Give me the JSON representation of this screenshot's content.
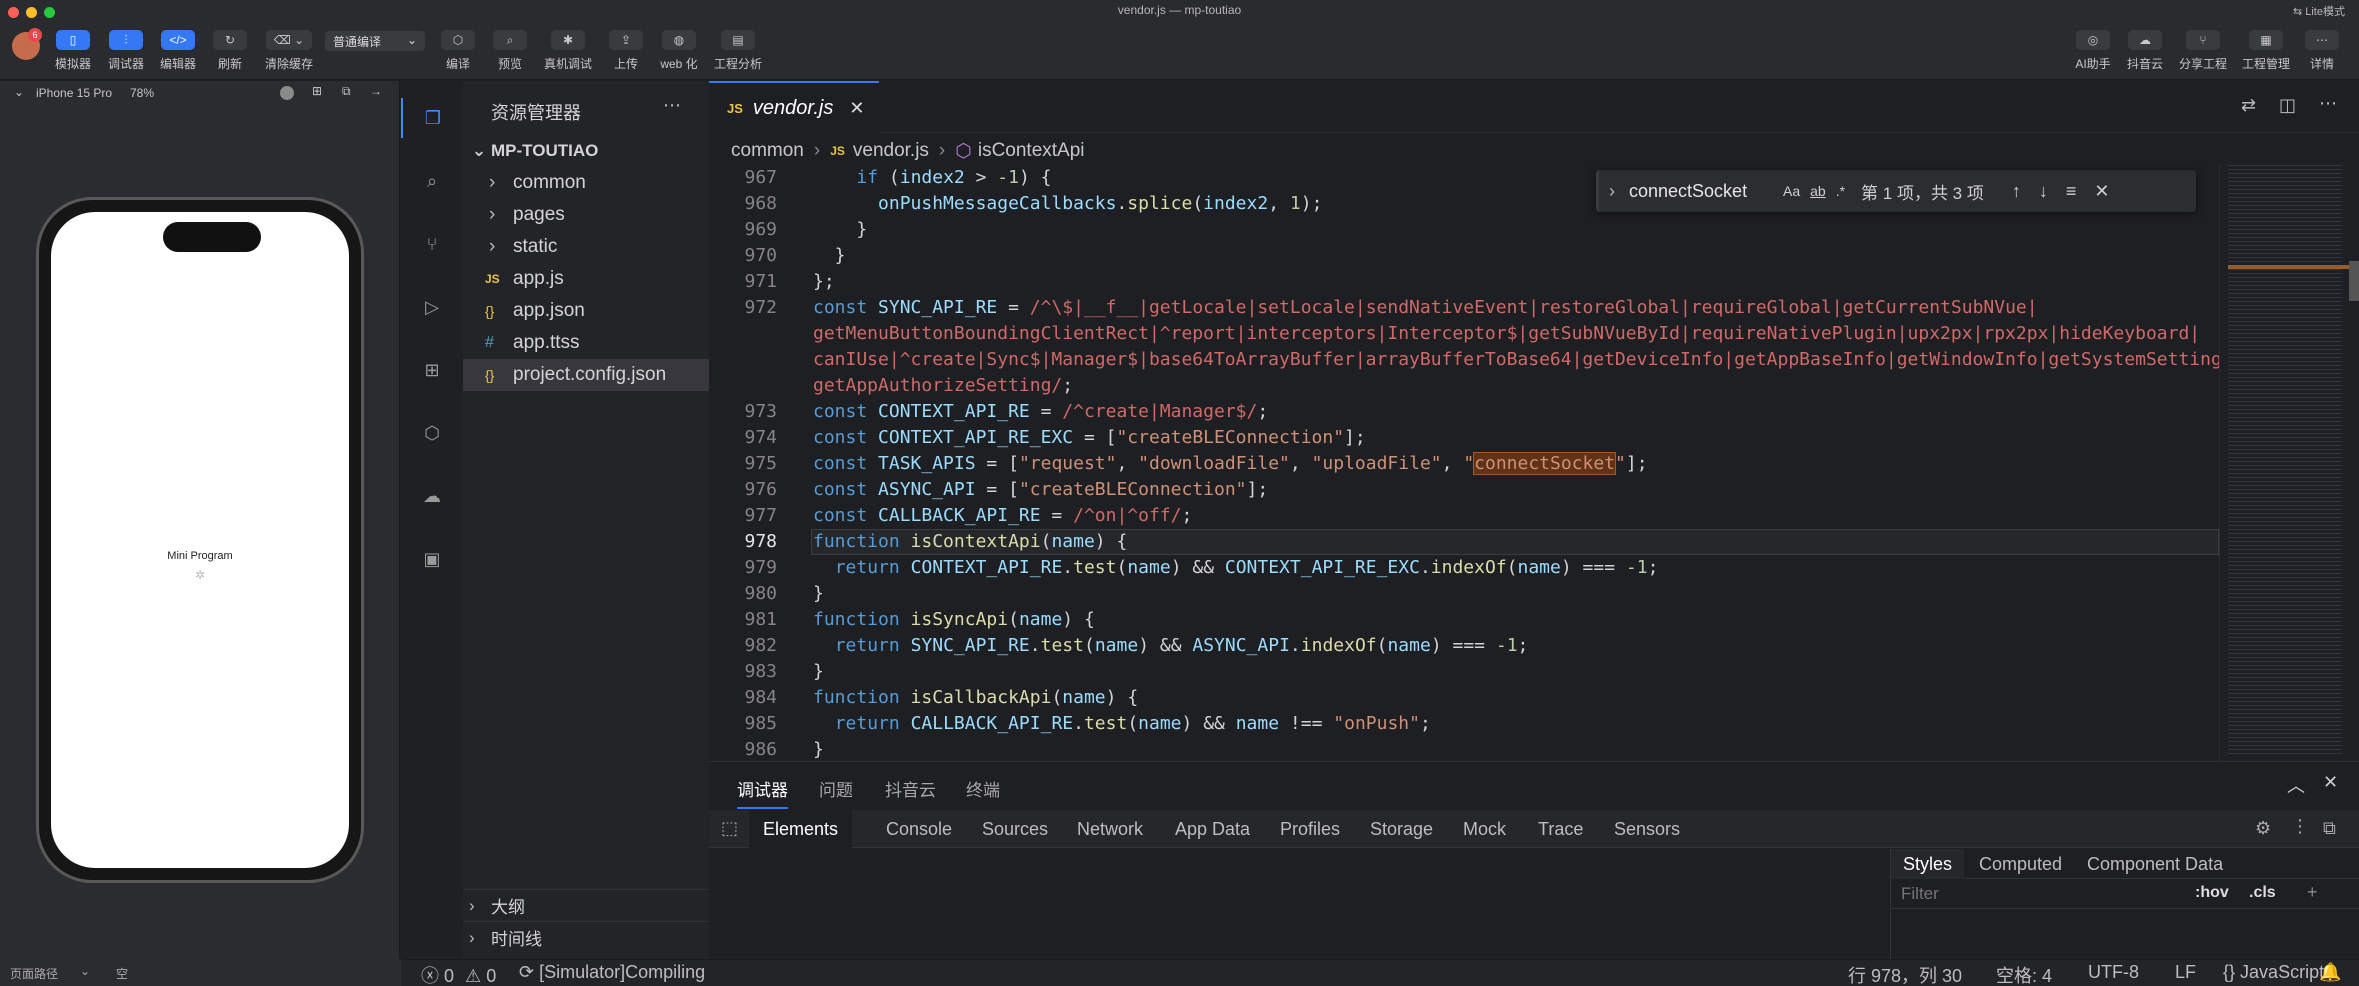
{
  "window": {
    "title": "vendor.js — mp-toutiao",
    "lite_mode": "Lite模式"
  },
  "toolbar": {
    "avatar_badge": "6",
    "left": [
      {
        "label": "模拟器",
        "icon": "phone-icon"
      },
      {
        "label": "调试器",
        "icon": "sliders-icon"
      },
      {
        "label": "编辑器",
        "icon": "code-icon"
      },
      {
        "label": "刷新",
        "icon": "refresh-icon"
      },
      {
        "label": "清除缓存",
        "icon": "clear-cache-icon"
      }
    ],
    "compile_mode": "普通编译",
    "middle": [
      {
        "label": "编译",
        "icon": "compile-icon"
      },
      {
        "label": "预览",
        "icon": "preview-icon"
      },
      {
        "label": "真机调试",
        "icon": "bug-icon"
      },
      {
        "label": "上传",
        "icon": "upload-icon"
      },
      {
        "label": "web 化",
        "icon": "globe-icon"
      },
      {
        "label": "工程分析",
        "icon": "analysis-icon"
      }
    ],
    "right": [
      {
        "label": "AI助手",
        "icon": "ai-icon"
      },
      {
        "label": "抖音云",
        "icon": "cloud-icon"
      },
      {
        "label": "分享工程",
        "icon": "share-icon"
      },
      {
        "label": "工程管理",
        "icon": "project-icon"
      },
      {
        "label": "详情",
        "icon": "details-icon"
      }
    ]
  },
  "simulator": {
    "device": "iPhone 15 Pro",
    "zoom": "78%",
    "screen_title": "Mini Program",
    "footer_path": "页面路径",
    "footer_empty": "空"
  },
  "explorer": {
    "title": "资源管理器",
    "project": "MP-TOUTIAO",
    "items": [
      {
        "name": "common",
        "type": "folder",
        "icon": ">"
      },
      {
        "name": "pages",
        "type": "folder",
        "icon": ">"
      },
      {
        "name": "static",
        "type": "folder",
        "icon": ">"
      },
      {
        "name": "app.js",
        "type": "js",
        "icon": "JS"
      },
      {
        "name": "app.json",
        "type": "json",
        "icon": "{}"
      },
      {
        "name": "app.ttss",
        "type": "css",
        "icon": "#"
      },
      {
        "name": "project.config.json",
        "type": "json",
        "icon": "{}",
        "selected": true
      }
    ],
    "outline": "大纲",
    "timeline": "时间线"
  },
  "editor": {
    "tab_label": "vendor.js",
    "tab_lang": "JS",
    "breadcrumb": [
      "common",
      "vendor.js",
      "isContextApi"
    ],
    "find": {
      "query": "connectSocket",
      "result": "第 1 项，共 3 项",
      "case": "Aa",
      "word": "ab",
      "regex": ".*"
    },
    "line_numbers": [
      "967",
      "968",
      "969",
      "970",
      "971",
      "972",
      "",
      "",
      "",
      "973",
      "974",
      "975",
      "976",
      "977",
      "978",
      "979",
      "980",
      "981",
      "982",
      "983",
      "984",
      "985",
      "986"
    ],
    "active_line": "978"
  },
  "panel": {
    "tabs": [
      "调试器",
      "问题",
      "抖音云",
      "终端"
    ],
    "devtools_tabs": [
      "Elements",
      "Console",
      "Sources",
      "Network",
      "App Data",
      "Profiles",
      "Storage",
      "Mock",
      "Trace",
      "Sensors"
    ],
    "styles_tabs": [
      "Styles",
      "Computed",
      "Component Data"
    ],
    "filter_placeholder": "Filter",
    "hov": ":hov",
    "cls": ".cls"
  },
  "status": {
    "errors": "0",
    "warnings": "0",
    "compiling": "[Simulator]Compiling",
    "position": "行 978，列 30",
    "spaces": "空格: 4",
    "encoding": "UTF-8",
    "eol": "LF",
    "language": "JavaScript"
  }
}
